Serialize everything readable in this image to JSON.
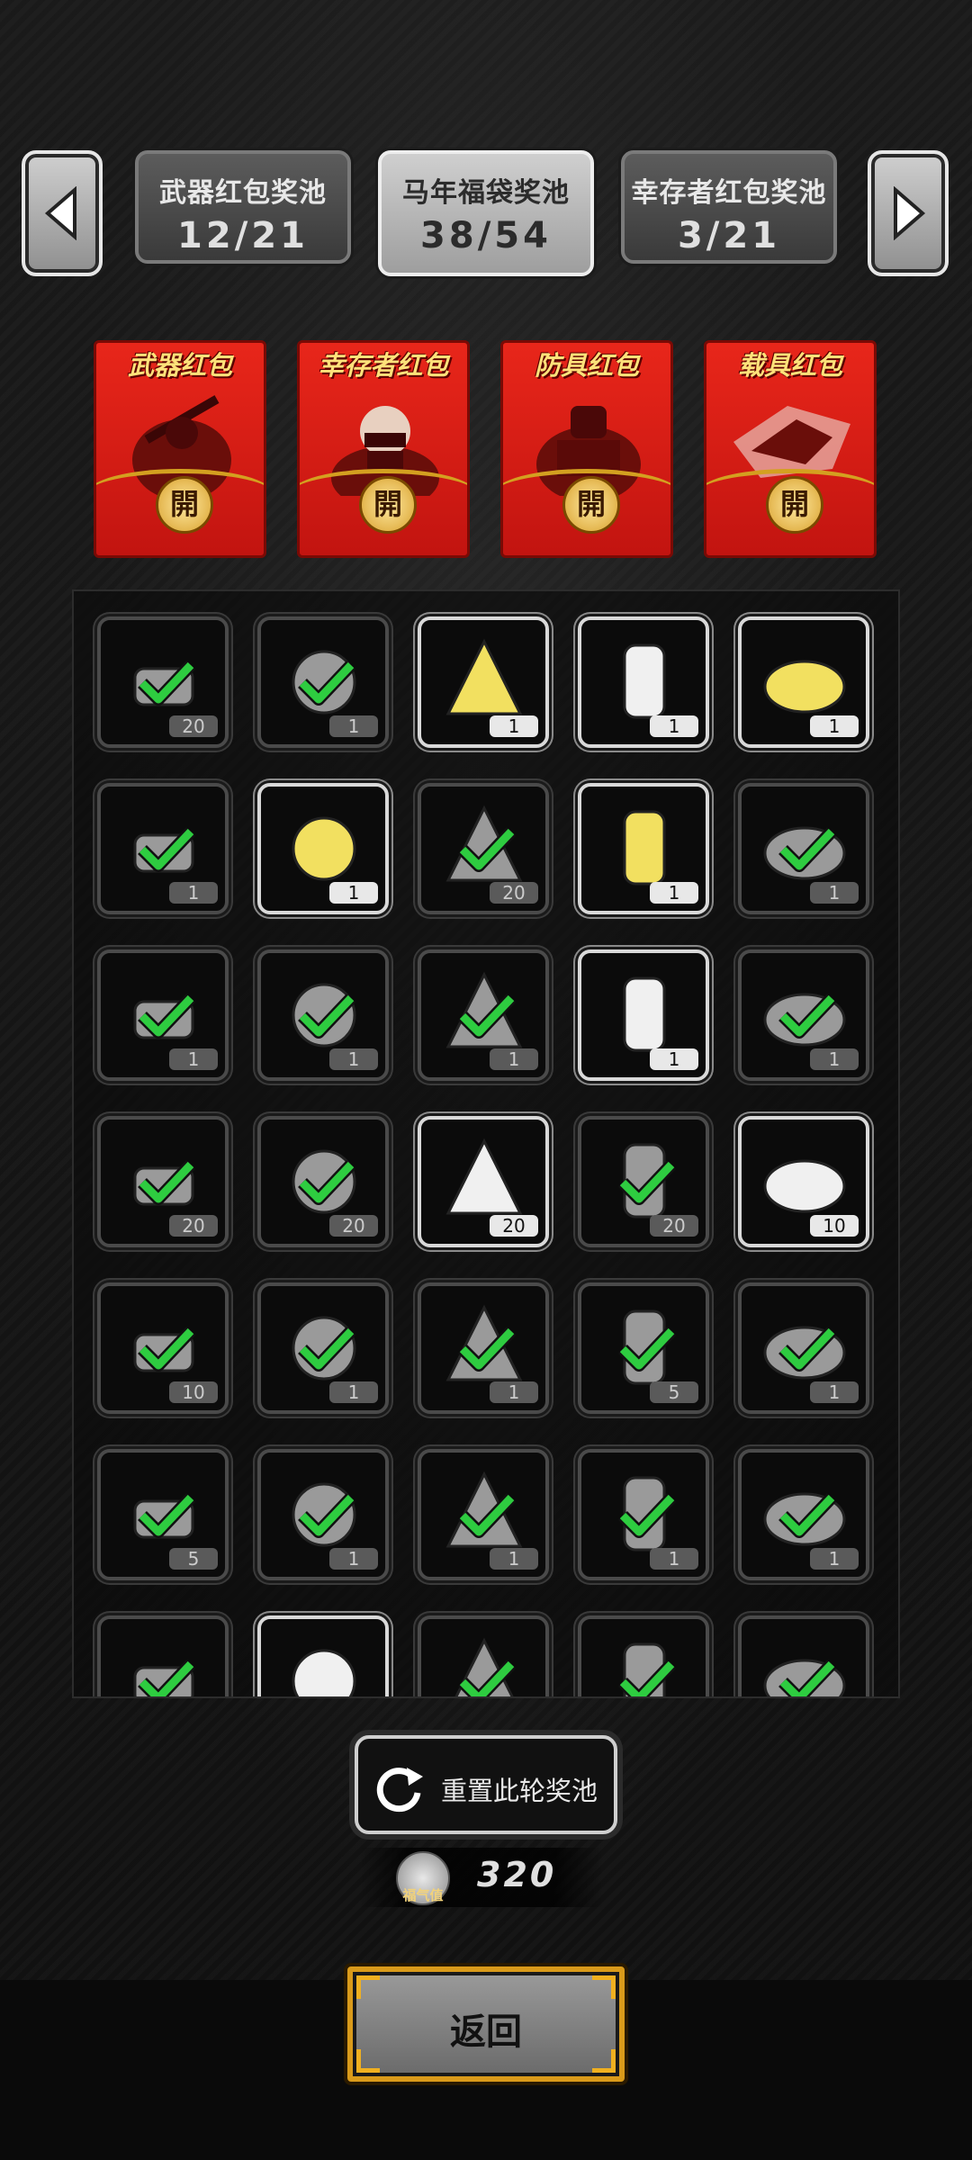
{
  "pool_tabs": [
    {
      "name": "武器红包奖池",
      "count": "12/21",
      "active": false
    },
    {
      "name": "马年福袋奖池",
      "count": "38/54",
      "active": true
    },
    {
      "name": "幸存者红包奖池",
      "count": "3/21",
      "active": false
    }
  ],
  "nav": {
    "prev_icon": "left-arrow-icon",
    "next_icon": "right-arrow-icon"
  },
  "envelopes": [
    {
      "title": "武器红包",
      "open": "開",
      "art": "weapon-soldier-icon"
    },
    {
      "title": "幸存者红包",
      "open": "開",
      "art": "survivor-helmet-icon"
    },
    {
      "title": "防具红包",
      "open": "開",
      "art": "armor-soldier-icon"
    },
    {
      "title": "载具红包",
      "open": "開",
      "art": "vehicle-icon"
    }
  ],
  "items": [
    {
      "icon": "tool-icon",
      "qty": "20",
      "checked": true,
      "bright": false
    },
    {
      "icon": "pickaxe-bag-icon",
      "qty": "1",
      "checked": true,
      "bright": false
    },
    {
      "icon": "gold-nuggets-icon",
      "qty": "1",
      "checked": false,
      "bright": true
    },
    {
      "icon": "wood-planks-icon",
      "qty": "1",
      "checked": false,
      "bright": true
    },
    {
      "icon": "gold-parts-icon",
      "qty": "1",
      "checked": false,
      "bright": true
    },
    {
      "icon": "cloth-icon",
      "qty": "1",
      "checked": true,
      "bright": false
    },
    {
      "icon": "gold-rods-icon",
      "qty": "1",
      "checked": false,
      "bright": true
    },
    {
      "icon": "cash-bundle-icon",
      "qty": "20",
      "checked": true,
      "bright": false
    },
    {
      "icon": "silver-bars-icon",
      "qty": "1",
      "checked": false,
      "bright": true
    },
    {
      "icon": "vase-icon",
      "qty": "1",
      "checked": true,
      "bright": false
    },
    {
      "icon": "ring-icon",
      "qty": "1",
      "checked": true,
      "bright": false
    },
    {
      "icon": "food-bowl-icon",
      "qty": "1",
      "checked": true,
      "bright": false
    },
    {
      "icon": "coffee-cup-icon",
      "qty": "1",
      "checked": true,
      "bright": false
    },
    {
      "icon": "candy-bowl-icon",
      "qty": "1",
      "checked": false,
      "bright": true
    },
    {
      "icon": "gift-box-icon",
      "qty": "1",
      "checked": true,
      "bright": false
    },
    {
      "icon": "battery-icon",
      "qty": "20",
      "checked": true,
      "bright": false
    },
    {
      "icon": "bullet-icon",
      "qty": "20",
      "checked": true,
      "bright": false
    },
    {
      "icon": "fuel-barrel-icon",
      "qty": "20",
      "checked": false,
      "bright": true
    },
    {
      "icon": "rifle-bullet-icon",
      "qty": "20",
      "checked": true,
      "bright": false
    },
    {
      "icon": "pen-icon",
      "qty": "10",
      "checked": false,
      "bright": true
    },
    {
      "icon": "tube-icon",
      "qty": "10",
      "checked": true,
      "bright": false
    },
    {
      "icon": "drink-cup-icon",
      "qty": "1",
      "checked": true,
      "bright": false
    },
    {
      "icon": "jar-icon",
      "qty": "1",
      "checked": true,
      "bright": false
    },
    {
      "icon": "net-globe-icon",
      "qty": "5",
      "checked": true,
      "bright": false
    },
    {
      "icon": "juice-glass-icon",
      "qty": "1",
      "checked": true,
      "bright": false
    },
    {
      "icon": "net-dome-icon",
      "qty": "5",
      "checked": true,
      "bright": false
    },
    {
      "icon": "knife-icon",
      "qty": "1",
      "checked": true,
      "bright": false
    },
    {
      "icon": "cloth-stack-icon",
      "qty": "1",
      "checked": true,
      "bright": false
    },
    {
      "icon": "bread-icon",
      "qty": "1",
      "checked": true,
      "bright": false
    },
    {
      "icon": "bottle-icon",
      "qty": "1",
      "checked": true,
      "bright": false
    },
    {
      "icon": "helmet-icon",
      "qty": "",
      "checked": true,
      "bright": false
    },
    {
      "icon": "eggs-icon",
      "qty": "",
      "checked": false,
      "bright": true
    },
    {
      "icon": "syringe-icon",
      "qty": "",
      "checked": true,
      "bright": false
    },
    {
      "icon": "tools-icon",
      "qty": "",
      "checked": true,
      "bright": false
    },
    {
      "icon": "helmet-2-icon",
      "qty": "",
      "checked": true,
      "bright": false
    }
  ],
  "reset": {
    "label": "重置此轮奖池",
    "icon": "refresh-icon"
  },
  "fortune": {
    "label": "福气值",
    "value": "320",
    "icon": "fortune-coin-icon"
  },
  "back": {
    "label": "返回"
  },
  "colors": {
    "check": "#2ecc40",
    "gold": "#f2d020",
    "envelope_red": "#e0201a",
    "frame_gold": "#e2a01c"
  }
}
